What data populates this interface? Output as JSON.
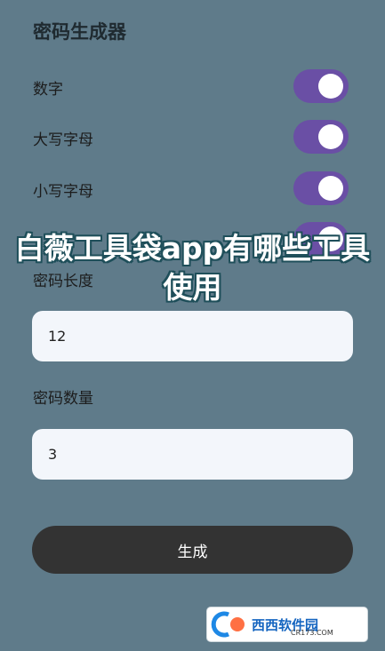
{
  "app": {
    "title": "密码生成器"
  },
  "options": [
    {
      "label": "数字",
      "on": true
    },
    {
      "label": "大写字母",
      "on": true
    },
    {
      "label": "小写字母",
      "on": true
    },
    {
      "label": "",
      "on": true
    }
  ],
  "length": {
    "label": "密码长度",
    "value": "12"
  },
  "count": {
    "label": "密码数量",
    "value": "3"
  },
  "generate_label": "生成",
  "overlay": {
    "line1": "白薇工具袋app有哪些工具",
    "line2": "使用"
  },
  "watermark": {
    "brand": "西西软件园",
    "sub": "CR173.COM"
  },
  "colors": {
    "background": "#5f7b8a",
    "toggle_on": "#6a4fa5",
    "button": "#333333"
  }
}
